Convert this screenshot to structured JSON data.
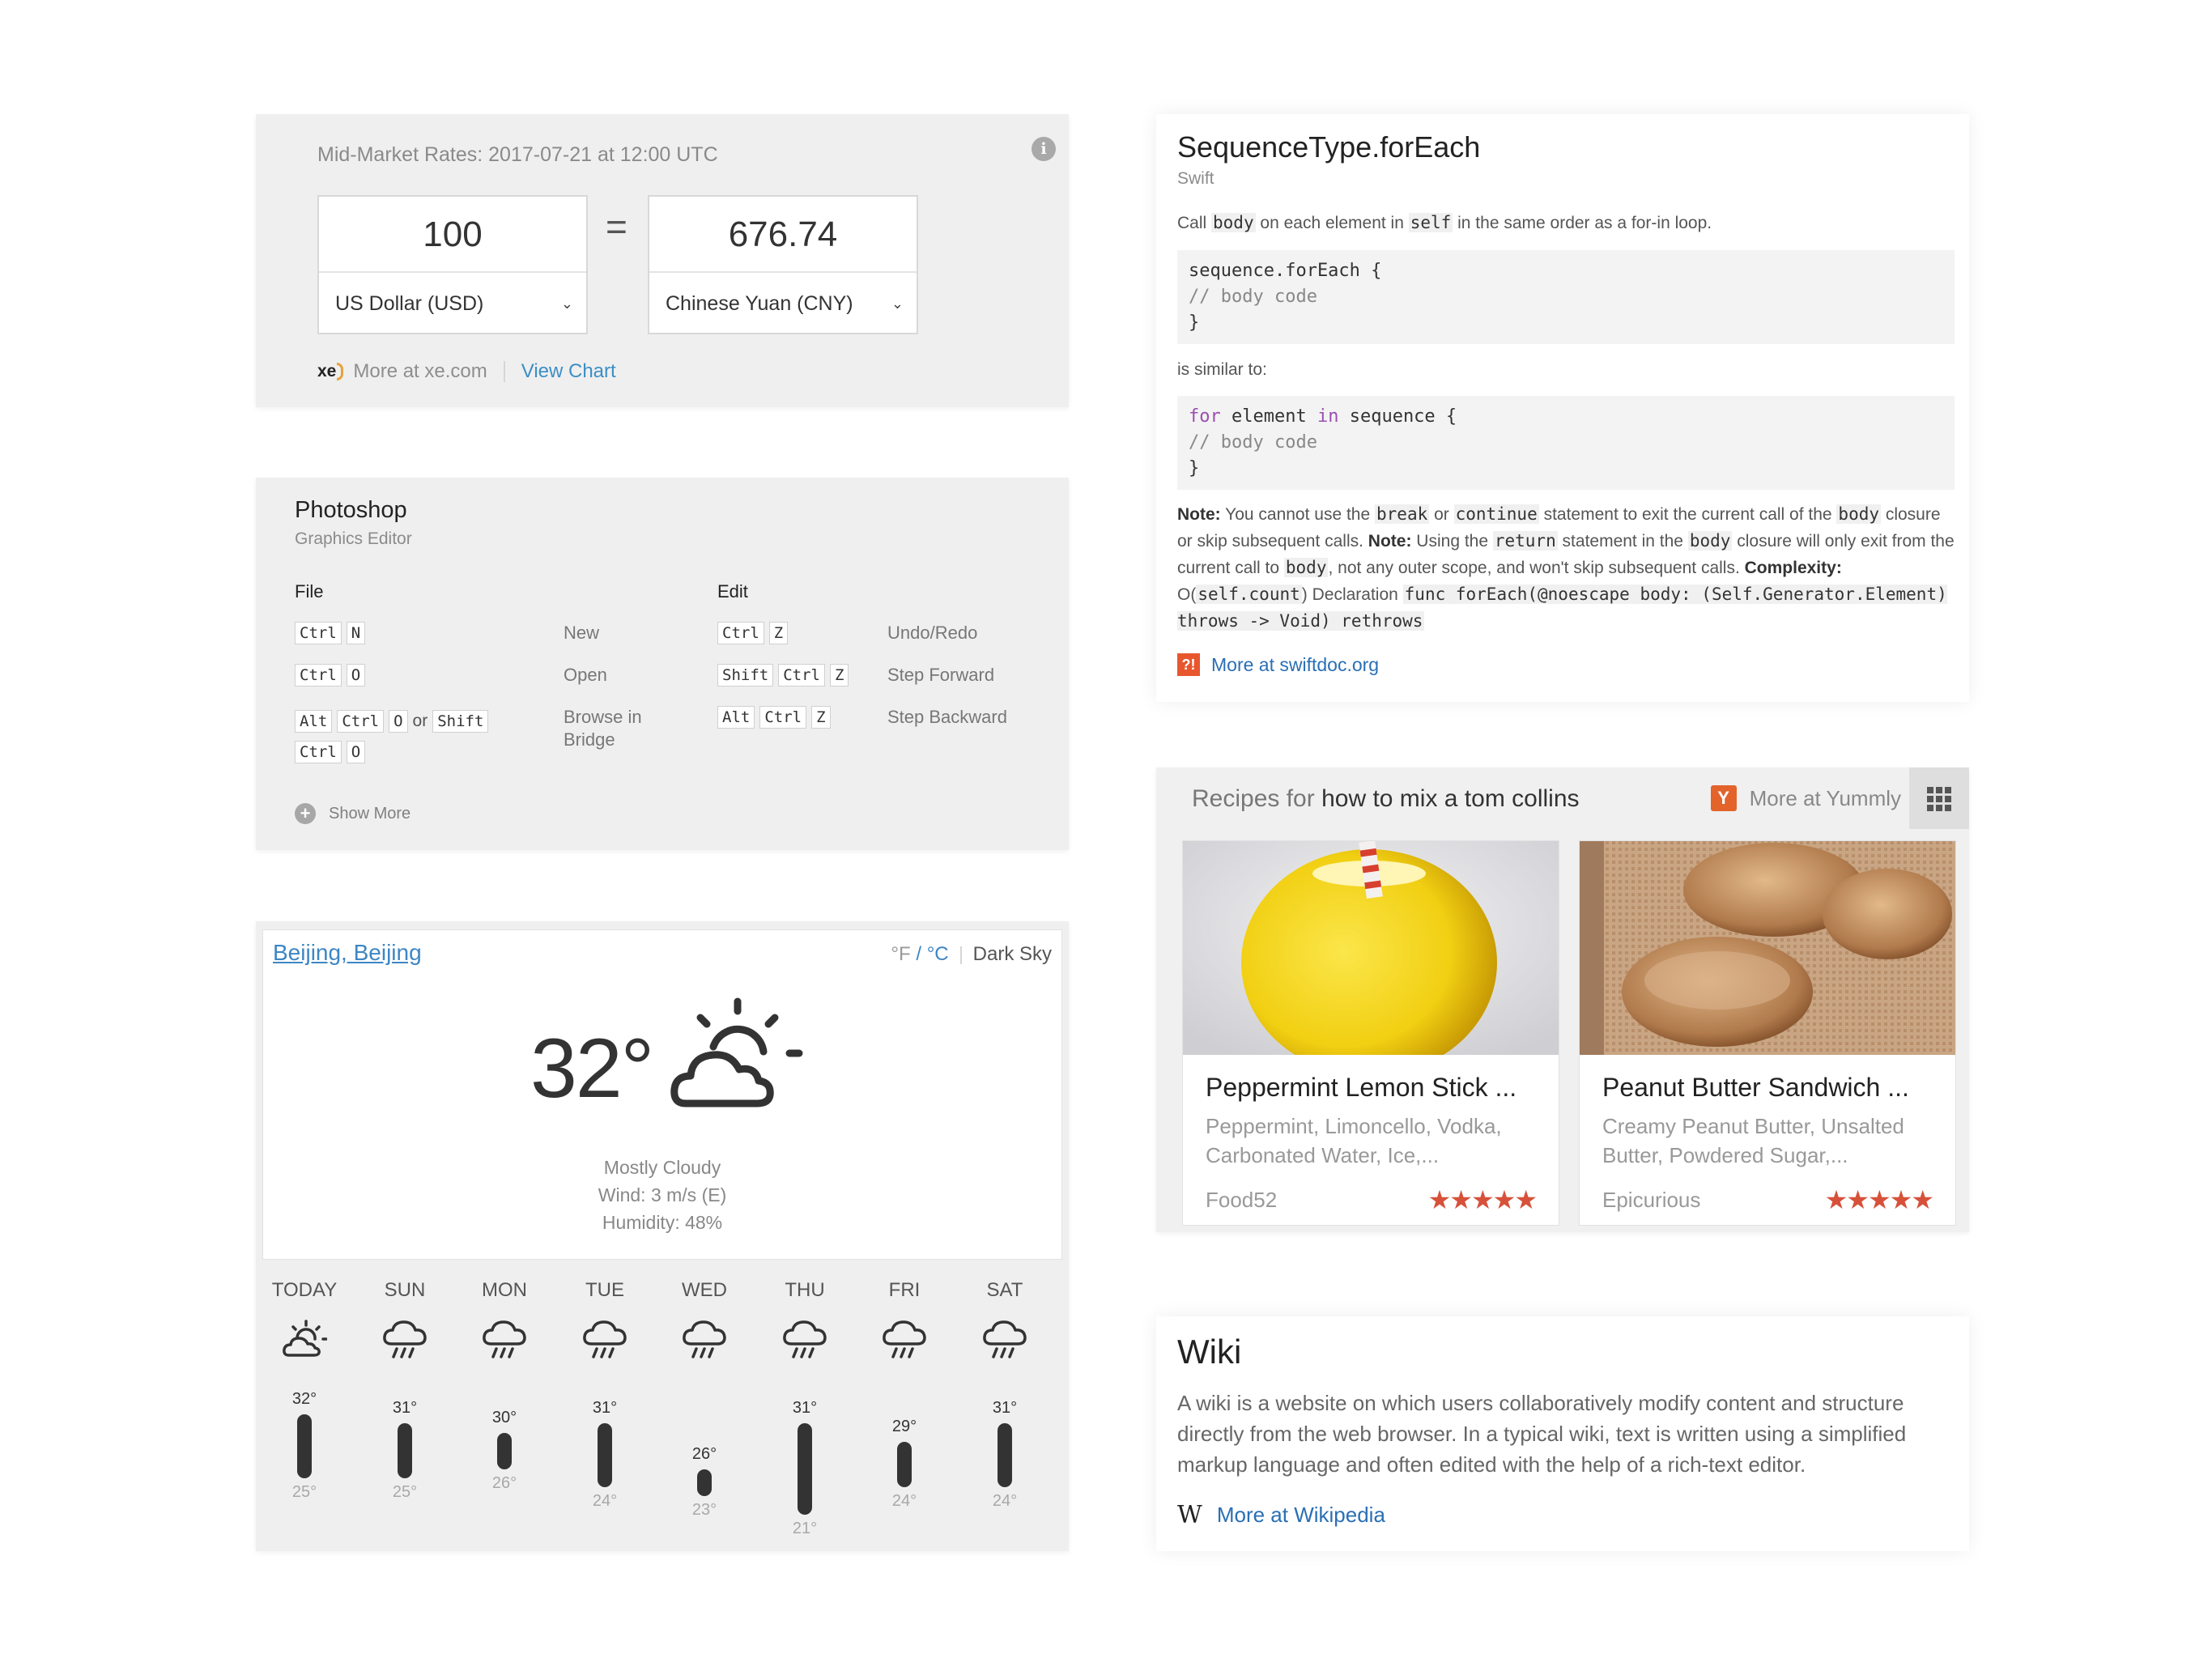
{
  "currency": {
    "title": "Mid-Market Rates: 2017-07-21 at 12:00 UTC",
    "info_icon": "i",
    "from_amount": "100",
    "from_unit": "US Dollar (USD)",
    "equals": "=",
    "to_amount": "676.74",
    "to_unit": "Chinese Yuan (CNY)",
    "source_logo": "xe",
    "source_link": "More at xe.com",
    "chart_link": "View Chart"
  },
  "photoshop": {
    "title": "Photoshop",
    "subtitle": "Graphics Editor",
    "file_header": "File",
    "edit_header": "Edit",
    "file_rows": [
      {
        "keys": [
          "Ctrl",
          "N"
        ],
        "desc": "New"
      },
      {
        "keys": [
          "Ctrl",
          "O"
        ],
        "desc": "Open"
      },
      {
        "keys": [
          "Alt",
          "Ctrl",
          "O"
        ],
        "or": "or",
        "keys2": [
          "Shift"
        ],
        "keys3": [
          "Ctrl",
          "O"
        ],
        "desc": "Browse in Bridge"
      }
    ],
    "edit_rows": [
      {
        "keys": [
          "Ctrl",
          "Z"
        ],
        "desc": "Undo/Redo"
      },
      {
        "keys": [
          "Shift",
          "Ctrl",
          "Z"
        ],
        "desc": "Step Forward"
      },
      {
        "keys": [
          "Alt",
          "Ctrl",
          "Z"
        ],
        "desc": "Step Backward"
      }
    ],
    "show_more": "Show More"
  },
  "weather": {
    "city": "Beijing, Beijing",
    "unit_f": "°F",
    "unit_slash": " / ",
    "unit_c": "°C",
    "source": "Dark Sky",
    "temp": "32°",
    "condition": "Mostly Cloudy",
    "wind": "Wind: 3 m/s (E)",
    "humidity": "Humidity: 48%",
    "days": [
      {
        "name": "TODAY",
        "icon": "partly-cloudy-icon",
        "hi": "32°",
        "lo": "25°",
        "hi_val": 32,
        "lo_val": 25
      },
      {
        "name": "SUN",
        "icon": "rain-icon",
        "hi": "31°",
        "lo": "25°",
        "hi_val": 31,
        "lo_val": 25
      },
      {
        "name": "MON",
        "icon": "rain-icon",
        "hi": "30°",
        "lo": "26°",
        "hi_val": 30,
        "lo_val": 26
      },
      {
        "name": "TUE",
        "icon": "rain-icon",
        "hi": "31°",
        "lo": "24°",
        "hi_val": 31,
        "lo_val": 24
      },
      {
        "name": "WED",
        "icon": "rain-icon",
        "hi": "26°",
        "lo": "23°",
        "hi_val": 26,
        "lo_val": 23
      },
      {
        "name": "THU",
        "icon": "rain-icon",
        "hi": "31°",
        "lo": "21°",
        "hi_val": 31,
        "lo_val": 21
      },
      {
        "name": "FRI",
        "icon": "rain-icon",
        "hi": "29°",
        "lo": "24°",
        "hi_val": 29,
        "lo_val": 24
      },
      {
        "name": "SAT",
        "icon": "rain-icon",
        "hi": "31°",
        "lo": "24°",
        "hi_val": 31,
        "lo_val": 24
      }
    ]
  },
  "swift": {
    "title": "SequenceType.forEach",
    "lang": "Swift",
    "intro_1": "Call ",
    "intro_code_1": "body",
    "intro_2": " on each element in ",
    "intro_code_2": "self",
    "intro_3": " in the same order as a for-in loop.",
    "code1_line1": "sequence.forEach {",
    "code1_line2": "// body code",
    "code1_line3": "}",
    "similar": "is similar to:",
    "code2_kw1": "for",
    "code2_mid": " element ",
    "code2_kw2": "in",
    "code2_end": " sequence {",
    "code2_line2": "// body code",
    "code2_line3": "}",
    "note_label": "Note:",
    "note_1": " You cannot use the ",
    "note_code_break": "break",
    "note_or": " or ",
    "note_code_continue": "continue",
    "note_2": " statement to exit the current call of the ",
    "note_code_body1": "body",
    "note_3": " closure or skip subsequent calls. ",
    "note_label2": "Note:",
    "note_4": " Using the ",
    "note_code_return": "return",
    "note_5": " statement in the ",
    "note_code_body2": "body",
    "note_6": " closure will only exit from the current call to ",
    "note_code_body3": "body",
    "note_7": ", not any outer scope, and won't skip subsequent calls. ",
    "complexity_label": "Complexity:",
    "note_8": " O(",
    "note_code_count": "self.count",
    "note_9": ") Declaration ",
    "note_code_decl": "func forEach(@noescape body: (Self.Generator.Element) throws -> Void) rethrows",
    "logo": "?!",
    "more": "More at swiftdoc.org"
  },
  "recipes": {
    "prefix": "Recipes for ",
    "query": "how to mix a tom collins",
    "logo": "Y",
    "more": "More at Yummly",
    "cards": [
      {
        "title": "Peppermint Lemon Stick ...",
        "ingredients": "Peppermint, Limoncello, Vodka, Carbonated Water, Ice,...",
        "source": "Food52",
        "stars": "★★★★★",
        "rating": 5
      },
      {
        "title": "Peanut Butter Sandwich ...",
        "ingredients": "Creamy Peanut Butter, Unsalted Butter, Powdered Sugar,...",
        "source": "Epicurious",
        "stars": "★★★★★",
        "rating": 5
      }
    ]
  },
  "wiki": {
    "title": "Wiki",
    "text": "A wiki is a website on which users collaboratively modify content and structure directly from the web browser. In a typical wiki, text is written using a simplified markup language and often edited with the help of a rich-text editor.",
    "logo": "W",
    "more": "More at Wikipedia"
  }
}
